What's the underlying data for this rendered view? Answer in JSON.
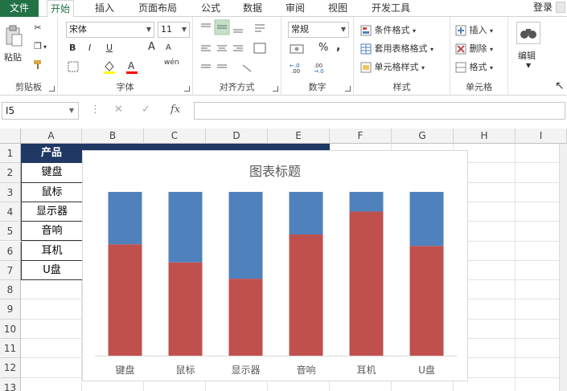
{
  "tabs": [
    "文件",
    "开始",
    "插入",
    "页面布局",
    "公式",
    "数据",
    "审阅",
    "视图",
    "开发工具"
  ],
  "login": "登录",
  "ribbon": {
    "clipboard": {
      "paste": "粘贴",
      "label": "剪贴板"
    },
    "font": {
      "name": "宋体",
      "size": "11",
      "bold": "B",
      "italic": "I",
      "underline": "U",
      "grow": "A",
      "shrink": "A",
      "label": "字体",
      "wen": "wén"
    },
    "align": {
      "label": "对齐方式"
    },
    "number": {
      "format": "常规",
      "percent": "%",
      "comma": ",",
      "label": "数字"
    },
    "styles": {
      "cond": "条件格式",
      "table": "套用表格格式",
      "cell": "单元格样式",
      "label": "样式"
    },
    "cells": {
      "insert": "插入",
      "delete": "删除",
      "format": "格式",
      "label": "单元格"
    },
    "edit": {
      "label": "编辑"
    }
  },
  "formula": {
    "namebox": "I5",
    "cancel": "✕",
    "confirm": "✓",
    "fx": "fx",
    "value": ""
  },
  "columns": [
    "A",
    "B",
    "C",
    "D",
    "E",
    "F",
    "G",
    "H",
    "I"
  ],
  "rows": [
    "1",
    "2",
    "3",
    "4",
    "5",
    "6",
    "7",
    "8",
    "9",
    "10",
    "11",
    "12",
    "13"
  ],
  "table": {
    "header": "产品",
    "items": [
      "键盘",
      "鼠标",
      "显示器",
      "音响",
      "耳机",
      "U盘"
    ]
  },
  "colors": {
    "accent": "#217346",
    "series_red": "#c0504d",
    "series_blue": "#4f81bd",
    "header_bg": "#1f3864"
  },
  "chart_data": {
    "type": "bar",
    "stacked": true,
    "percent": true,
    "title": "图表标题",
    "categories": [
      "键盘",
      "鼠标",
      "显示器",
      "音响",
      "耳机",
      "U盘"
    ],
    "series": [
      {
        "values": [
          0.68,
          0.57,
          0.47,
          0.74,
          0.88,
          0.67
        ]
      },
      {
        "values": [
          0.32,
          0.43,
          0.53,
          0.26,
          0.12,
          0.33
        ]
      }
    ],
    "ylim": [
      0,
      1
    ],
    "grid": false
  }
}
